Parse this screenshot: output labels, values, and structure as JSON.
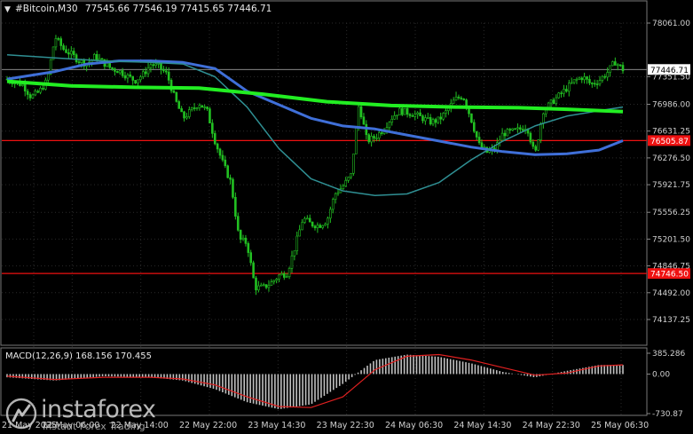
{
  "header": {
    "symbol": "#Bitcoin,M30",
    "ohlc": "77545.66 77546.19 77415.65 77446.71"
  },
  "colors": {
    "background": "#000000",
    "grid": "#2a2a2a",
    "axis_text": "#d0d0d0",
    "bull_candle": "#22c022",
    "ma_blue": "#3f6fd8",
    "ma_teal": "#2f8f93",
    "ma_green": "#22ee22",
    "level_red": "#ee1111",
    "macd_hist": "#c0c0c0",
    "macd_signal": "#e02020"
  },
  "brand": {
    "name": "instaforex",
    "tagline": "Instant Forex Trading"
  },
  "chart_data": [
    {
      "type": "candlestick",
      "title": "#Bitcoin,M30",
      "y_ticks": [
        "78061.00",
        "77351.50",
        "76986.00",
        "76631.25",
        "76276.50",
        "75921.75",
        "75556.25",
        "75201.50",
        "74846.75",
        "74492.00",
        "74137.25"
      ],
      "ylim": [
        74137.25,
        78061.0
      ],
      "x_ticks": [
        "21 May 2025",
        "22 May 06:00",
        "22 May 14:00",
        "22 May 22:00",
        "23 May 14:30",
        "23 May 22:30",
        "24 May 06:30",
        "24 May 14:30",
        "24 May 22:30",
        "25 May 06:30"
      ],
      "current_price": "77446.71",
      "levels": [
        {
          "label": "76505.87",
          "value": 76505.87
        },
        {
          "label": "74746.50",
          "value": 74746.5
        }
      ],
      "price_path": [
        {
          "x": 0,
          "y": 77320
        },
        {
          "x": 2,
          "y": 77240
        },
        {
          "x": 3,
          "y": 77080
        },
        {
          "x": 4,
          "y": 77150
        },
        {
          "x": 5,
          "y": 77300
        },
        {
          "x": 6,
          "y": 77880
        },
        {
          "x": 7,
          "y": 77720
        },
        {
          "x": 8,
          "y": 77650
        },
        {
          "x": 9,
          "y": 77560
        },
        {
          "x": 10,
          "y": 77520
        },
        {
          "x": 11,
          "y": 77620
        },
        {
          "x": 12,
          "y": 77540
        },
        {
          "x": 13,
          "y": 77460
        },
        {
          "x": 14,
          "y": 77430
        },
        {
          "x": 15,
          "y": 77360
        },
        {
          "x": 16,
          "y": 77300
        },
        {
          "x": 17,
          "y": 77380
        },
        {
          "x": 18,
          "y": 77520
        },
        {
          "x": 19,
          "y": 77480
        },
        {
          "x": 20,
          "y": 77380
        },
        {
          "x": 21,
          "y": 77050
        },
        {
          "x": 22,
          "y": 76800
        },
        {
          "x": 23,
          "y": 76900
        },
        {
          "x": 24,
          "y": 77000
        },
        {
          "x": 25,
          "y": 76900
        },
        {
          "x": 26,
          "y": 76500
        },
        {
          "x": 27,
          "y": 76200
        },
        {
          "x": 28,
          "y": 75950
        },
        {
          "x": 29,
          "y": 75200
        },
        {
          "x": 30,
          "y": 75150
        },
        {
          "x": 31,
          "y": 74560
        },
        {
          "x": 32,
          "y": 74560
        },
        {
          "x": 33,
          "y": 74620
        },
        {
          "x": 34,
          "y": 74720
        },
        {
          "x": 35,
          "y": 74750
        },
        {
          "x": 36,
          "y": 75100
        },
        {
          "x": 37,
          "y": 75480
        },
        {
          "x": 38,
          "y": 75400
        },
        {
          "x": 39,
          "y": 75380
        },
        {
          "x": 40,
          "y": 75450
        },
        {
          "x": 41,
          "y": 75800
        },
        {
          "x": 42,
          "y": 75900
        },
        {
          "x": 43,
          "y": 76050
        },
        {
          "x": 44,
          "y": 77000
        },
        {
          "x": 45,
          "y": 76500
        },
        {
          "x": 46,
          "y": 76550
        },
        {
          "x": 47,
          "y": 76650
        },
        {
          "x": 48,
          "y": 76800
        },
        {
          "x": 49,
          "y": 76900
        },
        {
          "x": 50,
          "y": 76880
        },
        {
          "x": 51,
          "y": 76850
        },
        {
          "x": 52,
          "y": 76800
        },
        {
          "x": 53,
          "y": 76750
        },
        {
          "x": 54,
          "y": 76780
        },
        {
          "x": 55,
          "y": 76900
        },
        {
          "x": 56,
          "y": 77050
        },
        {
          "x": 57,
          "y": 77100
        },
        {
          "x": 58,
          "y": 76800
        },
        {
          "x": 59,
          "y": 76450
        },
        {
          "x": 60,
          "y": 76350
        },
        {
          "x": 61,
          "y": 76400
        },
        {
          "x": 62,
          "y": 76600
        },
        {
          "x": 63,
          "y": 76620
        },
        {
          "x": 64,
          "y": 76650
        },
        {
          "x": 65,
          "y": 76700
        },
        {
          "x": 66,
          "y": 76300
        },
        {
          "x": 67,
          "y": 76900
        },
        {
          "x": 68,
          "y": 77000
        },
        {
          "x": 69,
          "y": 77100
        },
        {
          "x": 70,
          "y": 77200
        },
        {
          "x": 71,
          "y": 77300
        },
        {
          "x": 72,
          "y": 77350
        },
        {
          "x": 73,
          "y": 77250
        },
        {
          "x": 74,
          "y": 77300
        },
        {
          "x": 75,
          "y": 77400
        },
        {
          "x": 76,
          "y": 77550
        },
        {
          "x": 77,
          "y": 77446.71
        }
      ],
      "moving_averages": [
        {
          "color": "#3f6fd8",
          "points": [
            {
              "x": 0,
              "y": 77320
            },
            {
              "x": 6,
              "y": 77420
            },
            {
              "x": 10,
              "y": 77520
            },
            {
              "x": 14,
              "y": 77560
            },
            {
              "x": 18,
              "y": 77560
            },
            {
              "x": 22,
              "y": 77540
            },
            {
              "x": 26,
              "y": 77460
            },
            {
              "x": 30,
              "y": 77160
            },
            {
              "x": 34,
              "y": 76980
            },
            {
              "x": 38,
              "y": 76800
            },
            {
              "x": 42,
              "y": 76700
            },
            {
              "x": 46,
              "y": 76660
            },
            {
              "x": 50,
              "y": 76580
            },
            {
              "x": 54,
              "y": 76500
            },
            {
              "x": 58,
              "y": 76420
            },
            {
              "x": 62,
              "y": 76360
            },
            {
              "x": 66,
              "y": 76320
            },
            {
              "x": 70,
              "y": 76330
            },
            {
              "x": 74,
              "y": 76380
            },
            {
              "x": 77,
              "y": 76505
            }
          ]
        },
        {
          "color": "#2f8f93",
          "points": [
            {
              "x": 0,
              "y": 77640
            },
            {
              "x": 6,
              "y": 77600
            },
            {
              "x": 12,
              "y": 77560
            },
            {
              "x": 18,
              "y": 77540
            },
            {
              "x": 22,
              "y": 77520
            },
            {
              "x": 26,
              "y": 77350
            },
            {
              "x": 30,
              "y": 76950
            },
            {
              "x": 34,
              "y": 76400
            },
            {
              "x": 38,
              "y": 76000
            },
            {
              "x": 42,
              "y": 75840
            },
            {
              "x": 46,
              "y": 75780
            },
            {
              "x": 50,
              "y": 75800
            },
            {
              "x": 54,
              "y": 75950
            },
            {
              "x": 58,
              "y": 76250
            },
            {
              "x": 62,
              "y": 76500
            },
            {
              "x": 66,
              "y": 76700
            },
            {
              "x": 70,
              "y": 76830
            },
            {
              "x": 74,
              "y": 76900
            },
            {
              "x": 77,
              "y": 76950
            }
          ]
        },
        {
          "color": "#22ee22",
          "points": [
            {
              "x": 0,
              "y": 77290
            },
            {
              "x": 8,
              "y": 77230
            },
            {
              "x": 16,
              "y": 77210
            },
            {
              "x": 24,
              "y": 77200
            },
            {
              "x": 32,
              "y": 77120
            },
            {
              "x": 40,
              "y": 77020
            },
            {
              "x": 48,
              "y": 76970
            },
            {
              "x": 56,
              "y": 76950
            },
            {
              "x": 64,
              "y": 76940
            },
            {
              "x": 70,
              "y": 76920
            },
            {
              "x": 77,
              "y": 76890
            }
          ]
        }
      ]
    },
    {
      "type": "area",
      "title": "MACD(12,26,9) 168.156 170.455",
      "y_ticks": [
        "385.286",
        "0.00",
        "-730.87"
      ],
      "ylim": [
        -730.87,
        385.286
      ],
      "series": [
        {
          "name": "MACD",
          "kind": "histogram",
          "points": [
            {
              "x": 0,
              "y": -60
            },
            {
              "x": 6,
              "y": -120
            },
            {
              "x": 12,
              "y": -40
            },
            {
              "x": 18,
              "y": -60
            },
            {
              "x": 22,
              "y": -120
            },
            {
              "x": 26,
              "y": -280
            },
            {
              "x": 30,
              "y": -520
            },
            {
              "x": 34,
              "y": -650
            },
            {
              "x": 38,
              "y": -560
            },
            {
              "x": 42,
              "y": -180
            },
            {
              "x": 46,
              "y": 260
            },
            {
              "x": 50,
              "y": 360
            },
            {
              "x": 54,
              "y": 320
            },
            {
              "x": 58,
              "y": 200
            },
            {
              "x": 62,
              "y": 40
            },
            {
              "x": 66,
              "y": -60
            },
            {
              "x": 70,
              "y": 60
            },
            {
              "x": 74,
              "y": 168
            },
            {
              "x": 77,
              "y": 168.156
            }
          ]
        },
        {
          "name": "Signal",
          "kind": "line",
          "points": [
            {
              "x": 0,
              "y": -40
            },
            {
              "x": 6,
              "y": -100
            },
            {
              "x": 12,
              "y": -60
            },
            {
              "x": 18,
              "y": -60
            },
            {
              "x": 22,
              "y": -90
            },
            {
              "x": 26,
              "y": -200
            },
            {
              "x": 30,
              "y": -420
            },
            {
              "x": 34,
              "y": -600
            },
            {
              "x": 38,
              "y": -620
            },
            {
              "x": 42,
              "y": -420
            },
            {
              "x": 46,
              "y": 80
            },
            {
              "x": 50,
              "y": 330
            },
            {
              "x": 54,
              "y": 360
            },
            {
              "x": 58,
              "y": 260
            },
            {
              "x": 62,
              "y": 120
            },
            {
              "x": 66,
              "y": -20
            },
            {
              "x": 70,
              "y": 20
            },
            {
              "x": 74,
              "y": 150
            },
            {
              "x": 77,
              "y": 170.455
            }
          ]
        }
      ]
    }
  ]
}
